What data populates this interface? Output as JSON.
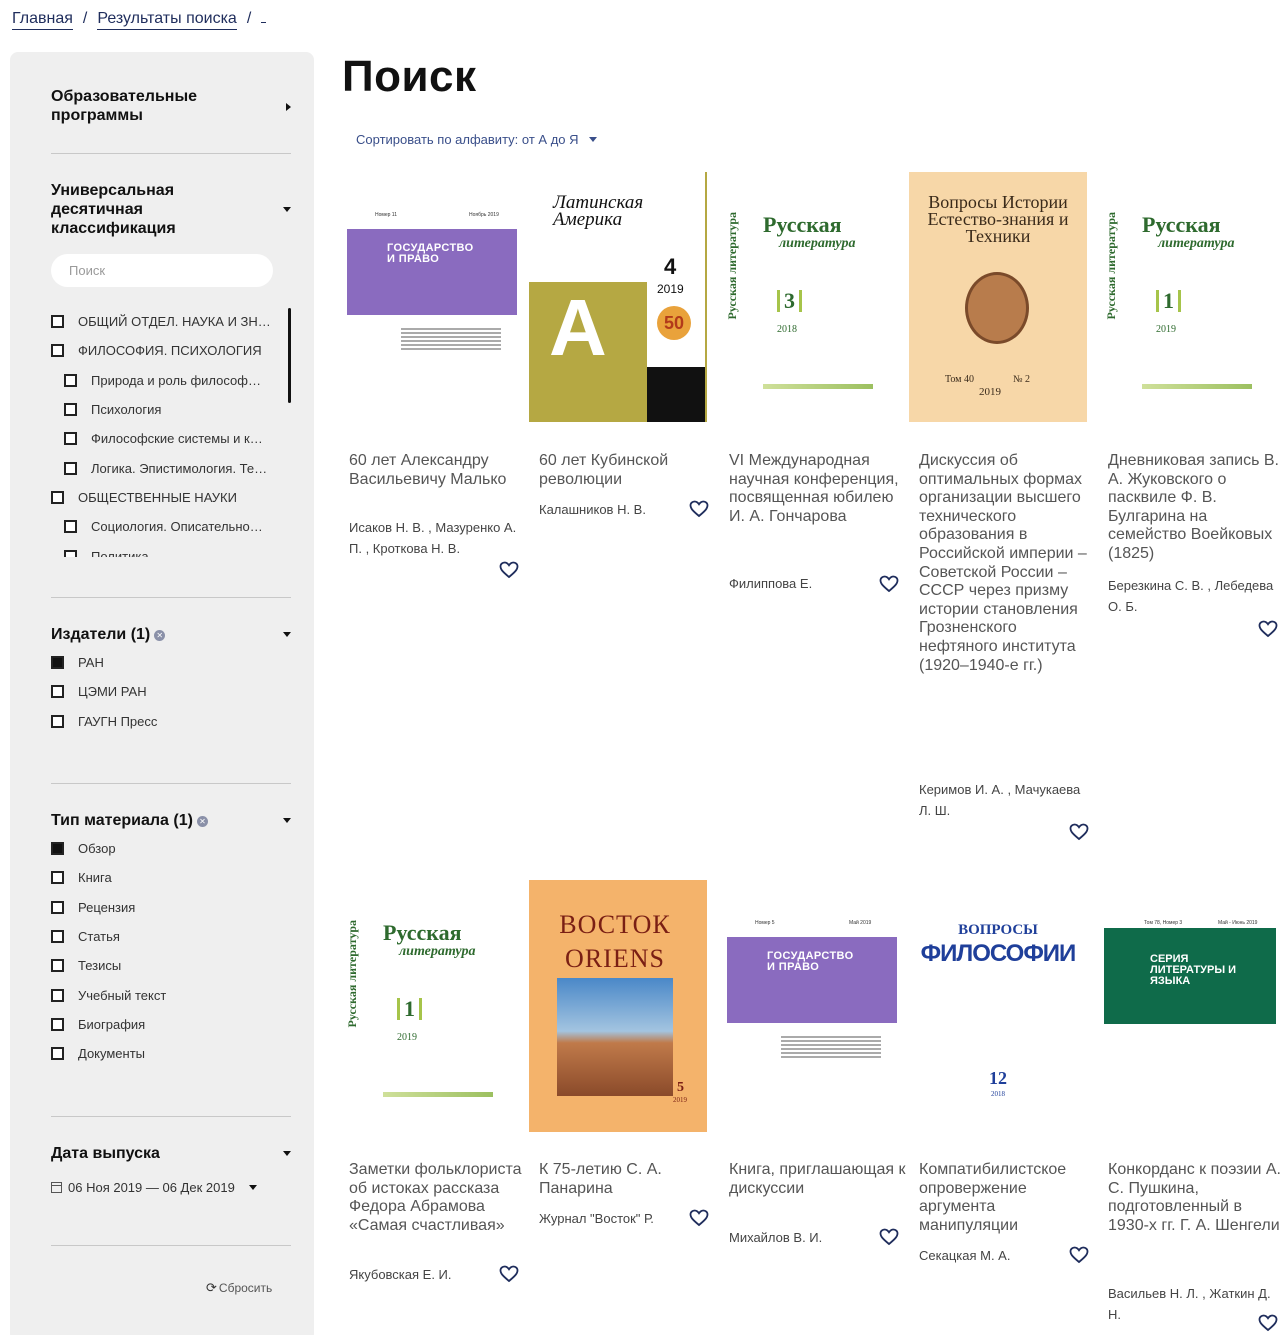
{
  "breadcrumb": {
    "home": "Главная",
    "results": "Результаты поиска",
    "sep1": "/",
    "sep2": "/"
  },
  "sidebar": {
    "edu_programs": "Образовательные программы",
    "udk_title": "Универсальная десятичная классификация",
    "udk_search_placeholder": "Поиск",
    "udk_items": [
      {
        "label": "ОБЩИЙ ОТДЕЛ. НАУКА И ЗН…",
        "level": 0
      },
      {
        "label": "ФИЛОСОФИЯ. ПСИХОЛОГИЯ",
        "level": 0
      },
      {
        "label": "Природа и роль философ…",
        "level": 1
      },
      {
        "label": "Психология",
        "level": 1
      },
      {
        "label": "Философские системы и к…",
        "level": 1
      },
      {
        "label": "Логика. Эпистимология. Те…",
        "level": 1
      },
      {
        "label": "ОБЩЕСТВЕННЫЕ НАУКИ",
        "level": 0
      },
      {
        "label": "Социология. Описательно…",
        "level": 1
      },
      {
        "label": "Политика",
        "level": 1
      }
    ],
    "publishers_title": "Издатели (1)",
    "publishers": [
      {
        "label": "РАН",
        "checked": true
      },
      {
        "label": "ЦЭМИ РАН",
        "checked": false
      },
      {
        "label": "ГАУГН Пресс",
        "checked": false
      }
    ],
    "type_title": "Тип материала (1)",
    "types": [
      {
        "label": "Обзор",
        "checked": true
      },
      {
        "label": "Книга",
        "checked": false
      },
      {
        "label": "Рецензия",
        "checked": false
      },
      {
        "label": "Статья",
        "checked": false
      },
      {
        "label": "Тезисы",
        "checked": false
      },
      {
        "label": "Учебный текст",
        "checked": false
      },
      {
        "label": "Биография",
        "checked": false
      },
      {
        "label": "Документы",
        "checked": false
      }
    ],
    "date_title": "Дата выпуска",
    "date_range": "06 Ноя 2019 — 06 Дек 2019",
    "reset": "Сбросить"
  },
  "main": {
    "title": "Поиск",
    "sort_label": "Сортировать по алфавиту: от А до Я",
    "cards": [
      {
        "title": "60 лет Александру Васильевичу Малько",
        "author": "Исаков Н. В. , Мазуренко А. П. , Кроткова Н. В.",
        "cover": "gos",
        "cover_text": "ГОСУДАРСТВО И ПРАВО",
        "cover_top": "Номер 11",
        "cover_top2": "Ноябрь 2019"
      },
      {
        "title": "60 лет Кубинской революции",
        "author": "Калашников Н. В.",
        "cover": "latam",
        "cover_text": "Латинская Америка",
        "cover_num": "4",
        "cover_year": "2019",
        "cover_badge": "50"
      },
      {
        "title": "VI Международная научная конференция, посвященная юбилею И. А. Гончарова",
        "author": "Филиппова Е.",
        "cover": "rl",
        "cover_side": "Русская литература",
        "cover_title1": "Русская",
        "cover_title2": "литература",
        "cover_num": "3",
        "cover_year": "2018"
      },
      {
        "title": "Дискуссия об оптимальных формах организации высшего технического образования в Российской империи – Советской России – СССР через призму истории становления Грозненского нефтяного института (1920–1940-е гг.)",
        "author": "Керимов И. А. , Мачукаева Л. Ш.",
        "cover": "vietek",
        "cover_text": "Вопросы Истории Естество-знания и Техники",
        "cover_tom": "Том 40",
        "cover_num": "№ 2",
        "cover_year": "2019"
      },
      {
        "title": "Дневниковая запись В. А. Жуковского о пасквиле Ф. В. Булгарина на семейство Воейковых (1825)",
        "author": "Березкина С. В. , Лебедева О. Б.",
        "cover": "rl",
        "cover_side": "Русская литература",
        "cover_title1": "Русская",
        "cover_title2": "литература",
        "cover_num": "1",
        "cover_year": "2019"
      },
      {
        "title": "Заметки фольклориста об истоках рассказа Федора Абрамова «Самая счастливая»",
        "author": "Якубовская Е. И.",
        "cover": "rl",
        "cover_side": "Русская литература",
        "cover_title1": "Русская",
        "cover_title2": "литература",
        "cover_num": "1",
        "cover_year": "2019"
      },
      {
        "title": "К 75-летию С. А. Панарина",
        "author": "Журнал \"Восток\" Р.",
        "cover": "vostok",
        "cover_text1": "ВОСТОК",
        "cover_text2": "ORIENS",
        "cover_num": "5",
        "cover_year": "2019"
      },
      {
        "title": "Книга, приглашающая к дискуссии",
        "author": "Михайлов В. И.",
        "cover": "gos",
        "cover_text": "ГОСУДАРСТВО И ПРАВО",
        "cover_top": "Номер 5",
        "cover_top2": "Май 2019"
      },
      {
        "title": "Компатибилистское опровержение аргумента манипуляции",
        "author": "Секацкая М. А.",
        "cover": "vf",
        "cover_text1": "ВОПРОСЫ",
        "cover_text2": "ФИЛОСОФИИ",
        "cover_num": "12",
        "cover_year": "2018"
      },
      {
        "title": "Конкорданс к поэзии А. С. Пушкина, подготовленный в 1930-х гг. Г. А. Шенгели",
        "author": "Васильев Н. Л. , Жаткин Д. Н.",
        "cover": "srl",
        "cover_text": "СЕРИЯ ЛИТЕРАТУРЫ И ЯЗЫКА",
        "cover_top": "Том 78, Номер 3",
        "cover_top2": "Май - Июнь 2019"
      }
    ]
  },
  "colors": {
    "accent": "#1f2d5c",
    "sidebar_bg": "#efefef",
    "purple": "#8a6bbf",
    "green": "#0f6b4a",
    "vostok_bg": "#f4b36b"
  },
  "icons": {
    "heart": "heart-icon",
    "calendar": "calendar-icon",
    "reset": "refresh-icon",
    "remove": "close-circle-icon"
  }
}
